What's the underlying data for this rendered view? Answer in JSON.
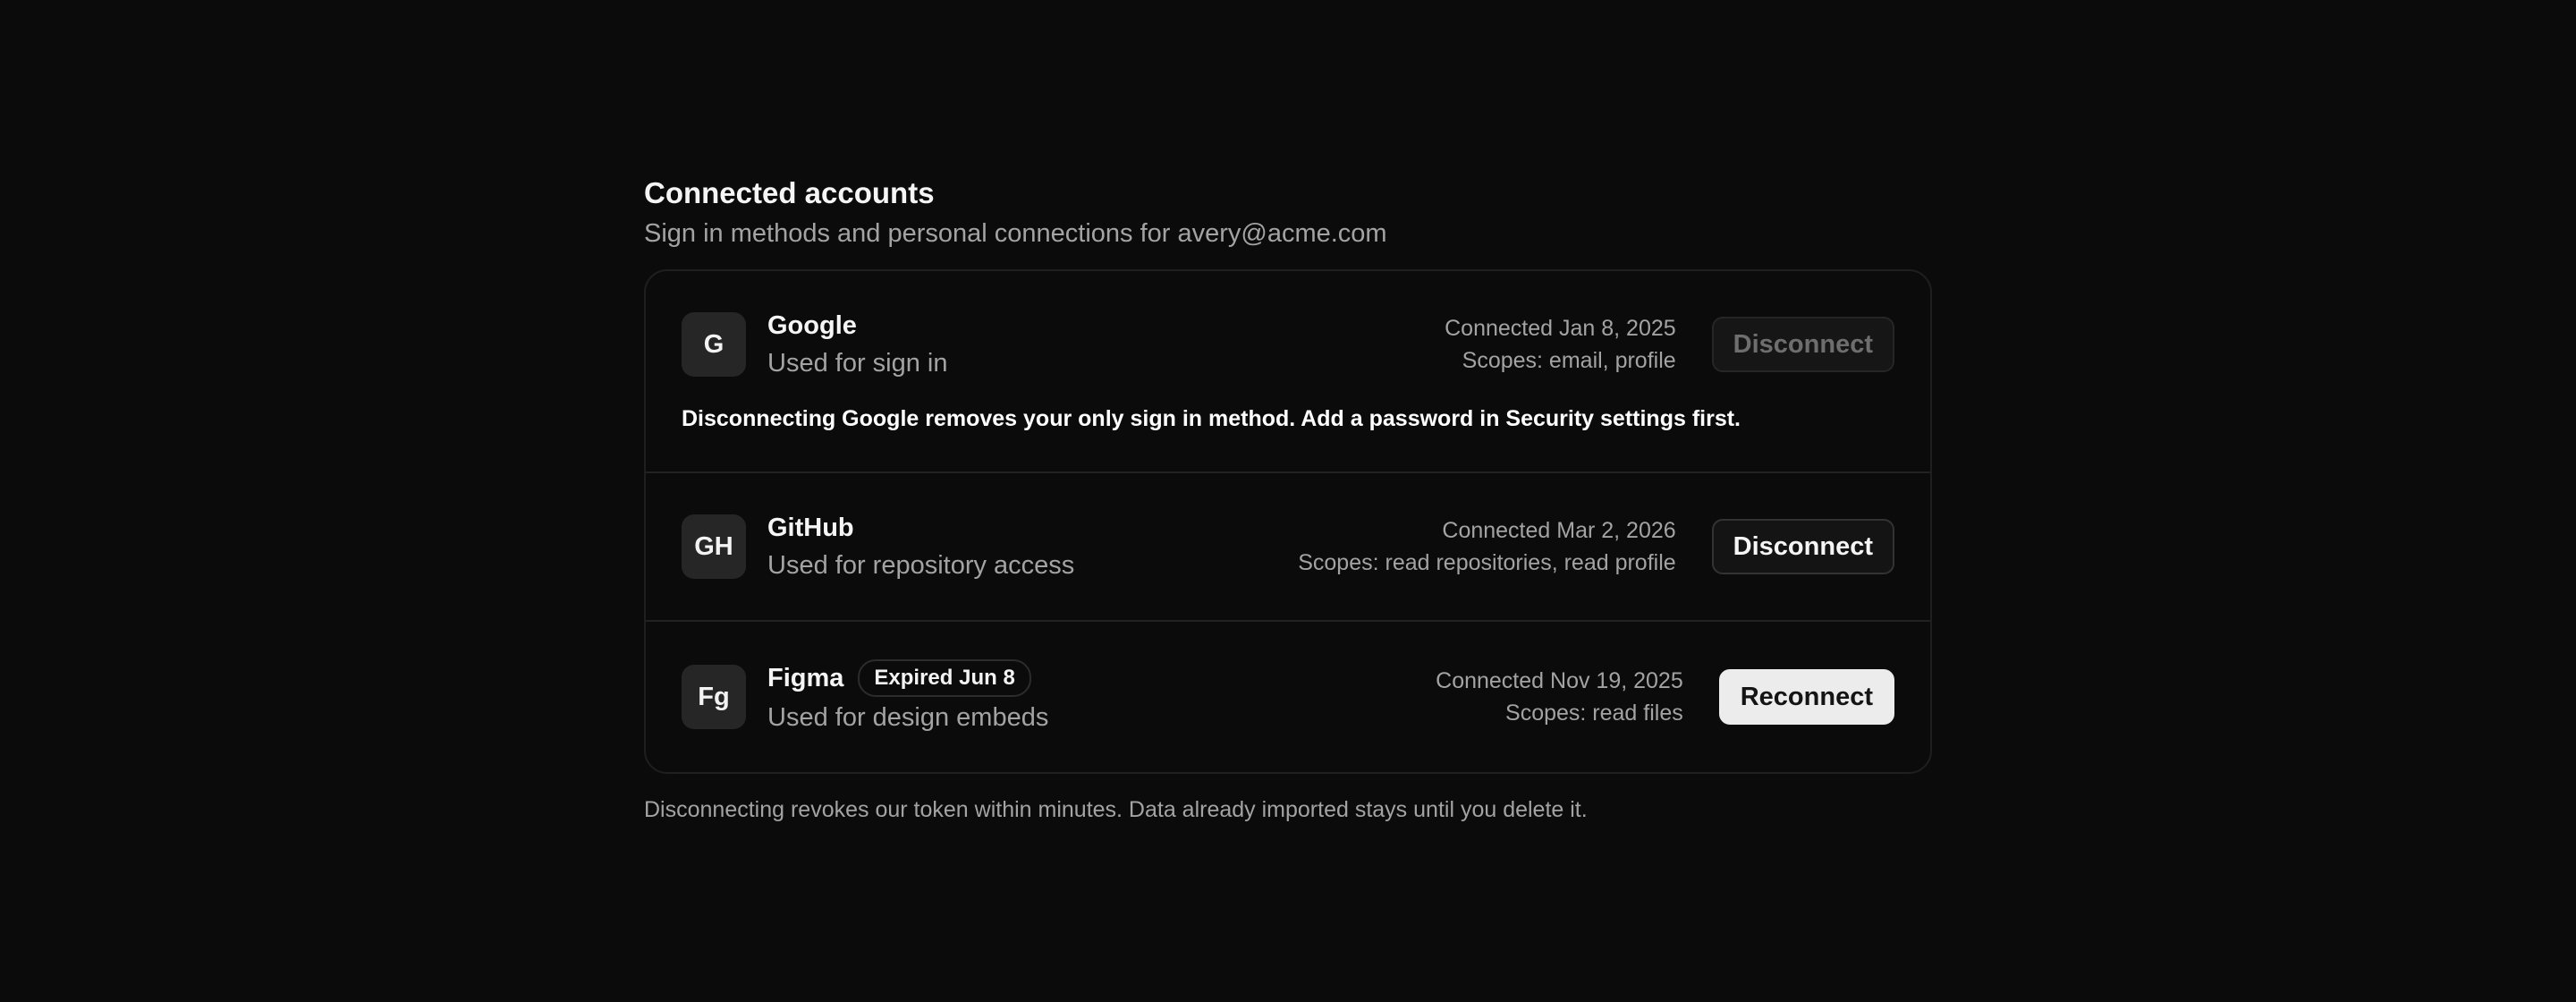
{
  "header": {
    "title": "Connected accounts",
    "subtitle": "Sign in methods and personal connections for avery@acme.com"
  },
  "accounts": [
    {
      "initials": "G",
      "name": "Google",
      "description": "Used for sign in",
      "connected": "Connected Jan 8, 2025",
      "scopes": "Scopes: email, profile",
      "action_label": "Disconnect",
      "action_enabled": false,
      "warning": "Disconnecting Google removes your only sign in method. Add a password in Security settings first."
    },
    {
      "initials": "GH",
      "name": "GitHub",
      "description": "Used for repository access",
      "connected": "Connected Mar 2, 2026",
      "scopes": "Scopes: read repositories, read profile",
      "action_label": "Disconnect",
      "action_enabled": true
    },
    {
      "initials": "Fg",
      "name": "Figma",
      "badge": "Expired Jun 8",
      "description": "Used for design embeds",
      "connected": "Connected Nov 19, 2025",
      "scopes": "Scopes: read files",
      "action_label": "Reconnect",
      "action_enabled": true
    }
  ],
  "footnote": "Disconnecting revokes our token within minutes. Data already imported stays until you delete it.",
  "colors": {
    "background": "#0b0b0b",
    "muted_text": "#a3a3a3",
    "primary_button": "#ececec"
  }
}
